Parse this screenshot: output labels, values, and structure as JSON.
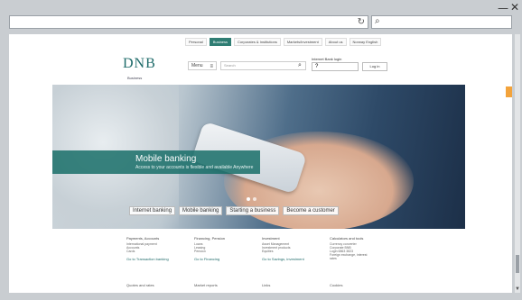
{
  "browser": {
    "minimize": "—",
    "close": "✕",
    "refresh_icon": "↻",
    "search_icon": "⌕"
  },
  "site": {
    "topnav": [
      "Personal",
      "Business",
      "Corporates & Institutions",
      "Markets/Investment",
      "About us",
      "Norway English"
    ],
    "topnav_active": 1,
    "logo": "DNB",
    "logo_sub": "Business",
    "menu_label": "Menu",
    "search_placeholder": "Search",
    "login_label": "Internet Bank login",
    "login_select": "?",
    "login_button": "Log in"
  },
  "hero": {
    "title": "Mobile banking",
    "subtitle": "Access to your accounts is flexible and available Anywhere",
    "quick_links": [
      "Internet banking",
      "Mobile banking",
      "Starting a business",
      "Become a customer"
    ]
  },
  "footer": {
    "columns": [
      {
        "heading": "Payments, Accounts",
        "items": [
          "International payment",
          "Accounts",
          "Cards"
        ],
        "link": "Go to Transaction banking"
      },
      {
        "heading": "Financing, Pension",
        "items": [
          "Loans",
          "Leasing",
          "Pension"
        ],
        "link": "Go to Financing"
      },
      {
        "heading": "Investment",
        "items": [
          "Asset Management",
          "Investment products",
          "Equities"
        ],
        "link": "Go to Savings, investment"
      },
      {
        "heading": "Calculators and tools",
        "items": [
          "Currency converter",
          "Corporate BNB",
          "Login 6863 3823",
          "Foreign exchange, interest",
          "rates"
        ],
        "link": ""
      }
    ],
    "bottom": [
      "Quotes and rates",
      "Market reports",
      "Links",
      "Cookies"
    ]
  }
}
